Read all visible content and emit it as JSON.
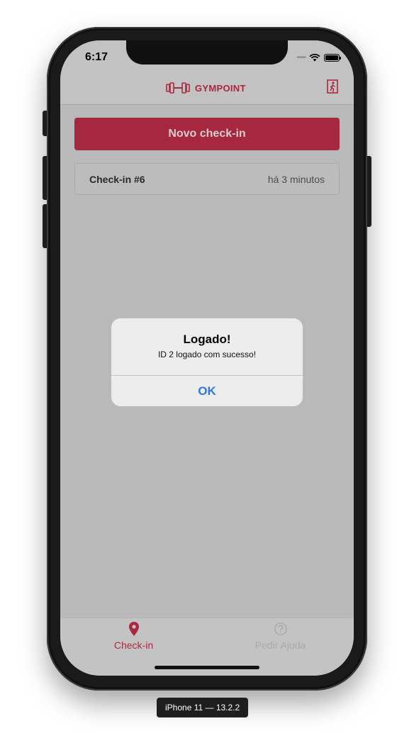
{
  "status_bar": {
    "time": "6:17"
  },
  "header": {
    "brand": "GYMPOINT",
    "logout_icon": "exit-door-icon"
  },
  "main": {
    "primary_button": "Novo check-in",
    "checkins": [
      {
        "title": "Check-in #6",
        "time": "há 3 minutos"
      }
    ]
  },
  "alert": {
    "title": "Logado!",
    "message": "ID 2 logado com sucesso!",
    "ok": "OK"
  },
  "tabs": [
    {
      "label": "Check-in",
      "icon": "map-pin-icon",
      "active": true
    },
    {
      "label": "Pedir Ajuda",
      "icon": "help-circle-icon",
      "active": false
    }
  ],
  "device": {
    "label": "iPhone 11 — 13.2.2"
  },
  "colors": {
    "brand": "#a8283f",
    "link": "#2e77e6",
    "overlay": "#b9b9b9"
  }
}
